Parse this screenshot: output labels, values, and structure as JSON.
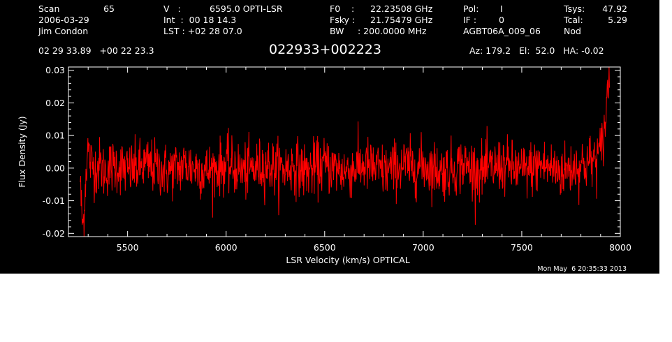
{
  "header": {
    "scan_label": "Scan",
    "scan_value": "65",
    "date": "2006-03-29",
    "observer": "Jim Condon",
    "v_label": "V   :",
    "v_value": "6595.0 OPTI-LSR",
    "int_line": "Int  :  00 18 14.3",
    "lst_line": "LST : +02 28 07.0",
    "f0_label": "F0    :",
    "f0_value": "22.23508 GHz",
    "fsky_label": "Fsky :",
    "fsky_value": "21.75479 GHz",
    "bw_label": "BW",
    "bw_value": ": 200.0000 MHz",
    "pol_label": "Pol:",
    "pol_value": "I",
    "if_label": "IF :",
    "if_value": "0",
    "project": "AGBT06A_009_06",
    "tsys_label": "Tsys:",
    "tsys_value": "47.92",
    "tcal_label": "Tcal:",
    "tcal_value": "5.29",
    "mode": "Nod",
    "coords": "02 29 33.89   +00 22 23.3",
    "source": "022933+002223",
    "pointing": "Az: 179.2   El:  52.0   HA: -0.02"
  },
  "footer": {
    "timestamp": "Mon May  6 20:35:33 2013"
  },
  "chart_data": {
    "type": "line",
    "xlabel": "LSR Velocity (km/s) OPTICAL",
    "ylabel": "Flux Density (Jy)",
    "xlim": [
      5200,
      8000
    ],
    "ylim": [
      -0.021,
      0.031
    ],
    "x_ticks": [
      5500,
      6000,
      6500,
      7000,
      7500,
      8000
    ],
    "x_tick_labels": [
      "5500",
      "6000",
      "6500",
      "7000",
      "7500",
      "8000"
    ],
    "y_ticks": [
      -0.02,
      -0.01,
      0.0,
      0.01,
      0.02,
      0.03
    ],
    "y_tick_labels": [
      "-0.02",
      "-0.01",
      "0.00",
      "0.01",
      "0.02",
      "0.03"
    ],
    "line_color": "#ff0000",
    "axis_color": "#ffffff",
    "background": "#000000",
    "series": [
      {
        "x": [
          5260,
          5265,
          5270,
          5275,
          5280,
          5285,
          5290,
          5295,
          5300,
          5310,
          5320,
          5340,
          5360,
          5380,
          5400,
          5450,
          5500,
          5550,
          5600,
          5650,
          5700,
          5750,
          5800,
          5850,
          5900,
          5950,
          6000,
          6050,
          6100,
          6150,
          6200,
          6250,
          6300,
          6350,
          6400,
          6450,
          6500,
          6550,
          6600,
          6650,
          6700,
          6750,
          6800,
          6850,
          6900,
          6950,
          7000,
          7050,
          7100,
          7150,
          7200,
          7250,
          7300,
          7350,
          7400,
          7450,
          7500,
          7550,
          7600,
          7650,
          7700,
          7750,
          7800,
          7850,
          7880,
          7900,
          7910,
          7920,
          7930,
          7935,
          7940,
          7945
        ],
        "y": [
          -0.003,
          -0.012,
          -0.016,
          -0.018,
          -0.012,
          -0.006,
          0.0,
          0.004,
          0.006,
          0.002,
          0.001,
          0.0,
          0.001,
          -0.001,
          0.0,
          0.001,
          -0.001,
          0.0,
          0.001,
          0.0,
          -0.001,
          0.0,
          0.001,
          0.0,
          -0.001,
          0.0,
          0.001,
          0.0,
          -0.001,
          0.0,
          0.001,
          0.0,
          0.0,
          0.001,
          -0.001,
          0.0,
          0.001,
          0.0,
          -0.001,
          0.0,
          0.001,
          0.0,
          -0.001,
          0.0,
          0.001,
          0.0,
          0.001,
          0.0,
          -0.001,
          0.0,
          0.001,
          0.0,
          -0.001,
          0.0,
          0.001,
          0.0,
          -0.001,
          0.0,
          0.001,
          0.0,
          -0.001,
          0.0,
          0.001,
          0.002,
          0.003,
          0.005,
          0.008,
          0.012,
          0.018,
          0.023,
          0.027,
          0.029
        ],
        "noise_rms": 0.005
      }
    ]
  }
}
